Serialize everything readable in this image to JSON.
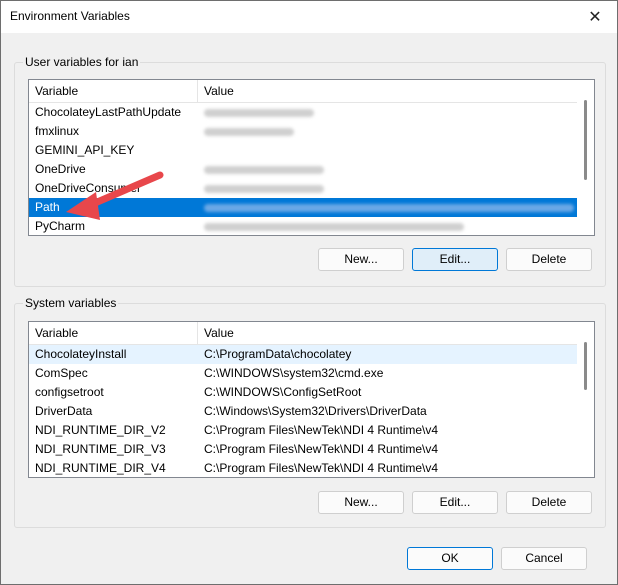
{
  "window": {
    "title": "Environment Variables",
    "close_glyph": "✕"
  },
  "user_section": {
    "label": "User variables for ian",
    "header": {
      "variable": "Variable",
      "value": "Value"
    },
    "rows": [
      {
        "name": "ChocolateyLastPathUpdate",
        "value_visible": false
      },
      {
        "name": "fmxlinux",
        "value_visible": false
      },
      {
        "name": "GEMINI_API_KEY",
        "value_visible": false
      },
      {
        "name": "OneDrive",
        "value_visible": false
      },
      {
        "name": "OneDriveConsumer",
        "value_visible": false
      },
      {
        "name": "Path",
        "value_visible": false,
        "selected": true
      },
      {
        "name": "PyCharm",
        "value_visible": false
      }
    ],
    "buttons": {
      "new": "New...",
      "edit": "Edit...",
      "delete": "Delete"
    }
  },
  "system_section": {
    "label": "System variables",
    "header": {
      "variable": "Variable",
      "value": "Value"
    },
    "rows": [
      {
        "name": "ChocolateyInstall",
        "value": "C:\\ProgramData\\chocolatey"
      },
      {
        "name": "ComSpec",
        "value": "C:\\WINDOWS\\system32\\cmd.exe"
      },
      {
        "name": "configsetroot",
        "value": "C:\\WINDOWS\\ConfigSetRoot"
      },
      {
        "name": "DriverData",
        "value": "C:\\Windows\\System32\\Drivers\\DriverData"
      },
      {
        "name": "NDI_RUNTIME_DIR_V2",
        "value": "C:\\Program Files\\NewTek\\NDI 4 Runtime\\v4"
      },
      {
        "name": "NDI_RUNTIME_DIR_V3",
        "value": "C:\\Program Files\\NewTek\\NDI 4 Runtime\\v4"
      },
      {
        "name": "NDI_RUNTIME_DIR_V4",
        "value": "C:\\Program Files\\NewTek\\NDI 4 Runtime\\v4"
      }
    ],
    "buttons": {
      "new": "New...",
      "edit": "Edit...",
      "delete": "Delete"
    }
  },
  "footer": {
    "ok": "OK",
    "cancel": "Cancel"
  },
  "colors": {
    "selection": "#0078d7",
    "annotation_arrow": "#e8474b"
  }
}
